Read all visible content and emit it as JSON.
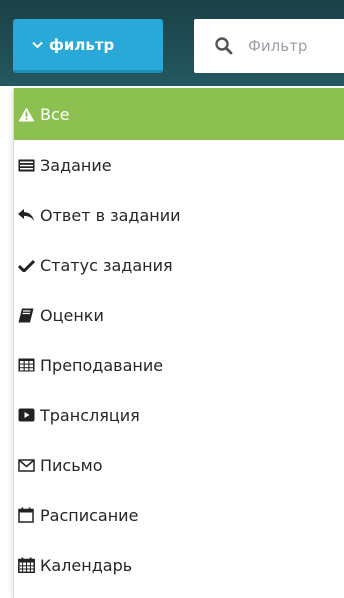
{
  "toolbar": {
    "filter_button_label": "фильтр",
    "search_placeholder": "Фильтр"
  },
  "menu": {
    "items": [
      {
        "label": "Все",
        "icon": "warning-icon",
        "active": true
      },
      {
        "label": "Задание",
        "icon": "list-icon"
      },
      {
        "label": "Ответ в задании",
        "icon": "reply-icon"
      },
      {
        "label": "Статус задания",
        "icon": "check-icon"
      },
      {
        "label": "Оценки",
        "icon": "book-icon"
      },
      {
        "label": "Преподавание",
        "icon": "table-icon"
      },
      {
        "label": "Трансляция",
        "icon": "play-icon"
      },
      {
        "label": "Письмо",
        "icon": "envelope-icon"
      },
      {
        "label": "Расписание",
        "icon": "calendar-empty-icon"
      },
      {
        "label": "Календарь",
        "icon": "calendar-grid-icon"
      }
    ]
  },
  "colors": {
    "header_bg": "#1d4a51",
    "button_blue": "#2aa8d8",
    "active_green": "#8cc152"
  }
}
